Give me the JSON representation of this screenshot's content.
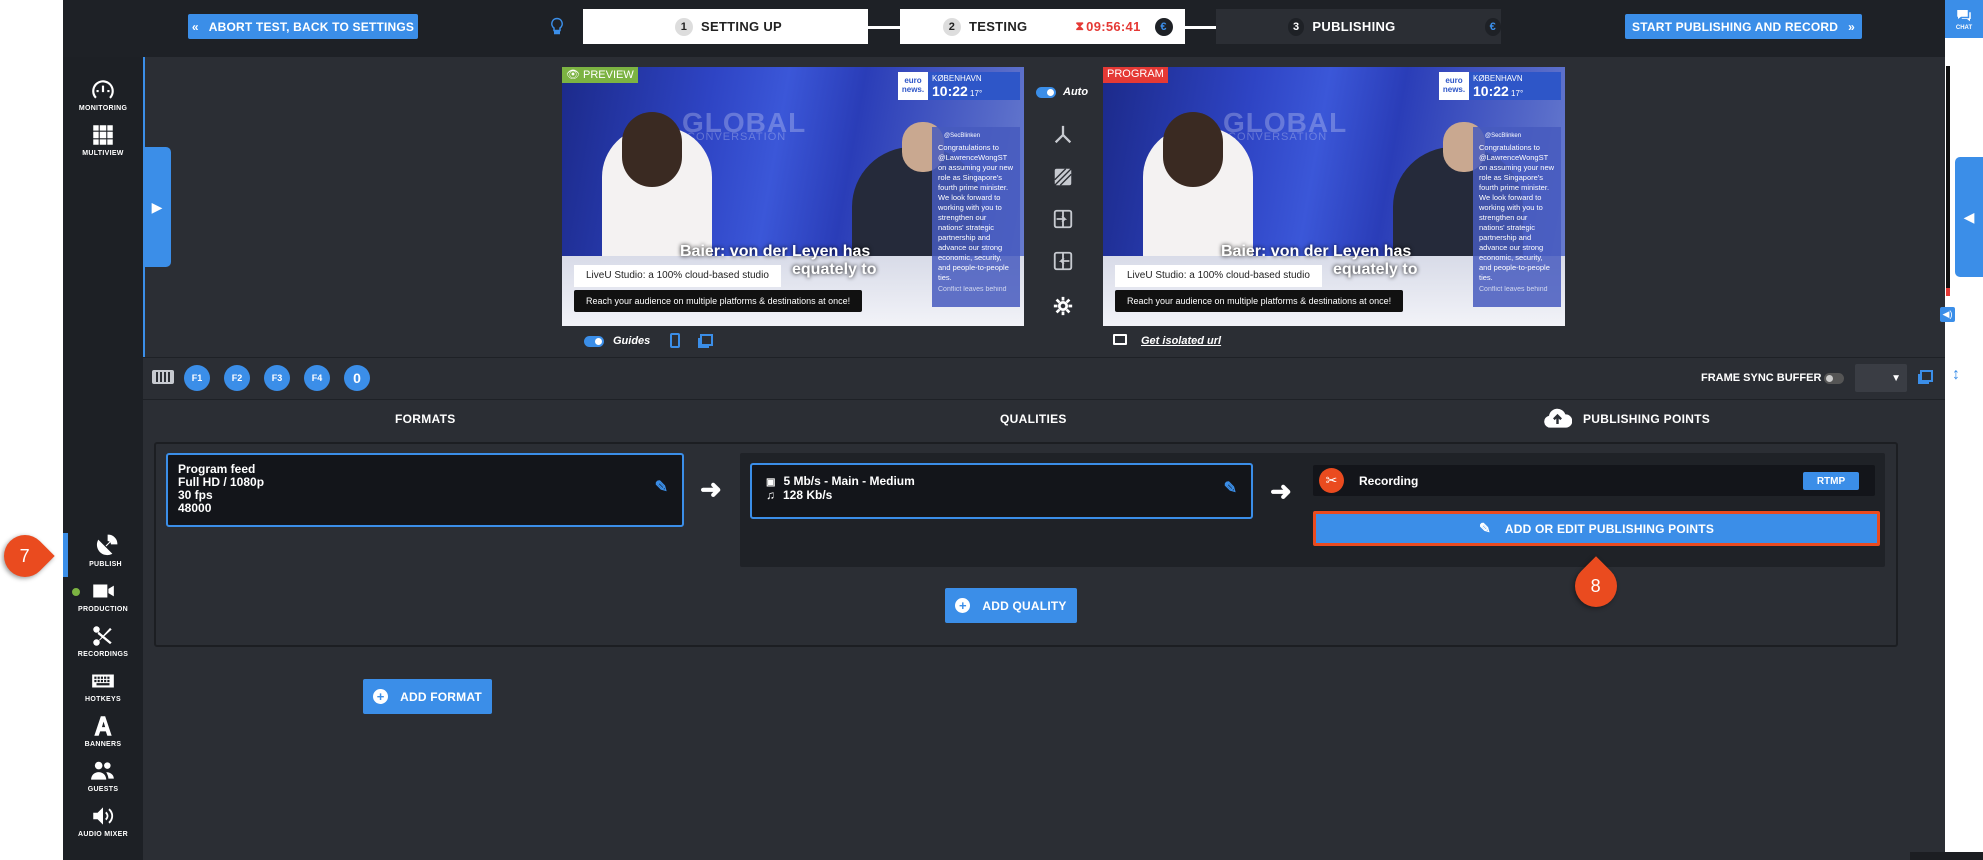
{
  "topbar": {
    "abort_label": "ABORT TEST, BACK TO SETTINGS",
    "start_label": "START PUBLISHING AND RECORD",
    "steps": [
      {
        "num": "1",
        "label": "SETTING UP"
      },
      {
        "num": "2",
        "label": "TESTING",
        "timer": "09:56:41"
      },
      {
        "num": "3",
        "label": "PUBLISHING"
      }
    ],
    "chat_label": "CHAT"
  },
  "sidebar": {
    "items": [
      {
        "label": "MONITORING",
        "icon": "gauge-icon"
      },
      {
        "label": "MULTIVIEW",
        "icon": "grid-icon"
      },
      {
        "label": "PUBLISH",
        "icon": "satellite-icon"
      },
      {
        "label": "PRODUCTION",
        "icon": "camera-icon"
      },
      {
        "label": "RECORDINGS",
        "icon": "scissors-icon"
      },
      {
        "label": "HOTKEYS",
        "icon": "keyboard-icon"
      },
      {
        "label": "BANNERS",
        "icon": "font-icon"
      },
      {
        "label": "GUESTS",
        "icon": "users-icon"
      },
      {
        "label": "AUDIO MIXER",
        "icon": "speaker-icon"
      }
    ]
  },
  "preview": {
    "tag": "PREVIEW",
    "guides_label": "Guides",
    "auto_label": "Auto",
    "logo_text": "euro news.",
    "city": "KØBENHAVN",
    "time": "10:22",
    "temp": "17°",
    "bg_title": "GLOBAL",
    "bg_subtitle": "CONVERSATION",
    "headline_1": "Baier: von der Leyen has",
    "headline_2": "equately to",
    "lower_third_1": "LiveU Studio: a 100% cloud-based studio",
    "lower_third_2": "Reach your audience on multiple platforms & destinations at once!",
    "tweet_handle": "@SecBlinken",
    "tweet": "Congratulations to @LawrenceWongST on assuming your new role as Singapore's fourth prime minister. We look forward to working with you to strengthen our nations' strategic partnership and advance our strong economic, security, and people-to-people ties.",
    "tweet_footer": "Conflict leaves behind"
  },
  "program": {
    "tag": "PROGRAM",
    "isolated_label": "Get isolated url"
  },
  "hotkeys": [
    "F1",
    "F2",
    "F3",
    "F4",
    "0"
  ],
  "frame_sync_label": "FRAME SYNC BUFFER",
  "panel": {
    "formats_header": "FORMATS",
    "qualities_header": "QUALITIES",
    "points_header": "PUBLISHING POINTS",
    "format": {
      "line1": "Program feed",
      "line2": "Full HD / 1080p",
      "line3": "30 fps",
      "line4": "48000"
    },
    "quality": {
      "video": "5 Mb/s  -  Main  -  Medium",
      "audio": "128 Kb/s"
    },
    "point": {
      "name": "Recording",
      "protocol": "RTMP"
    },
    "add_edit_points_label": "ADD OR EDIT PUBLISHING POINTS",
    "add_quality_label": "ADD QUALITY",
    "add_format_label": "ADD FORMAT"
  },
  "callouts": {
    "seven": "7",
    "eight": "8"
  },
  "colors": {
    "accent": "#3b8ee8",
    "callout": "#ea4b1f",
    "preview_tag": "#7cb342",
    "program_tag": "#e53935"
  }
}
